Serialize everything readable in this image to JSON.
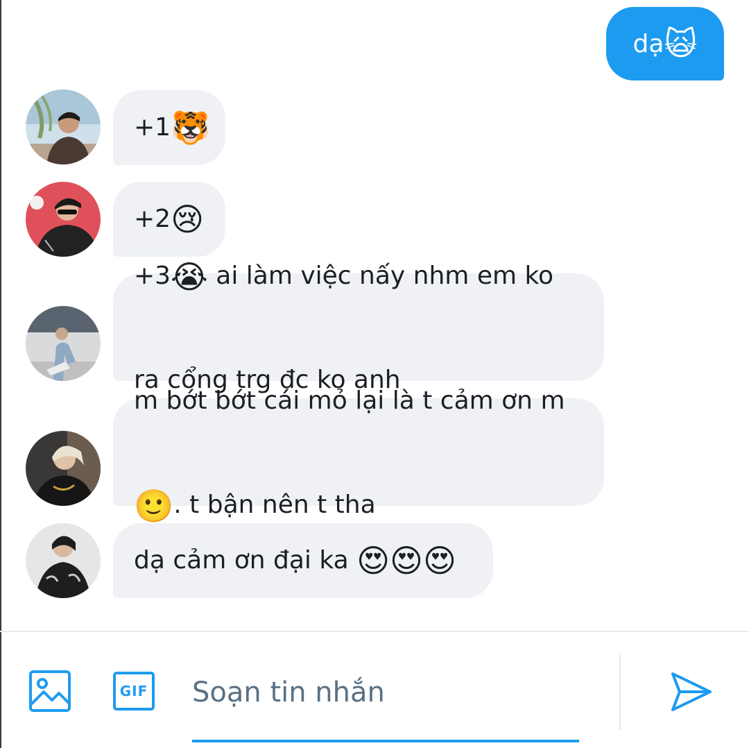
{
  "conversation": {
    "sent_messages": [
      {
        "text": "dạ ",
        "emoji": "🙀"
      }
    ],
    "received_messages": [
      {
        "text": "+1",
        "emoji_after": "🐯",
        "avatar": "avatar-1"
      },
      {
        "text": "+2",
        "emoji_after": "😢",
        "avatar": "avatar-2"
      },
      {
        "line1_prefix": "+3",
        "emoji_inline": "😭",
        "line1_suffix": " ai làm việc nấy nhm em ko",
        "line2": "ra cổng trg đc ko anh",
        "avatar": "avatar-3"
      },
      {
        "line1": "m bớt bớt cái mỏ lại là t cảm ơn m",
        "emoji_inline": "🙂",
        "line2_suffix": ". t bận nên t tha",
        "avatar": "avatar-4"
      },
      {
        "text": "dạ cảm ơn đại ka ",
        "emojis": "😍😍😍",
        "avatar": "avatar-5"
      }
    ]
  },
  "composer": {
    "placeholder": "Soạn tin nhắn",
    "value": "",
    "gif_label": "GIF",
    "icons": [
      "image-icon",
      "gif-icon",
      "send-icon"
    ]
  },
  "colors": {
    "accent": "#1d9bf0",
    "bubble_received": "#eff1f5",
    "text": "#1b1f23",
    "placeholder": "#5b7083"
  }
}
